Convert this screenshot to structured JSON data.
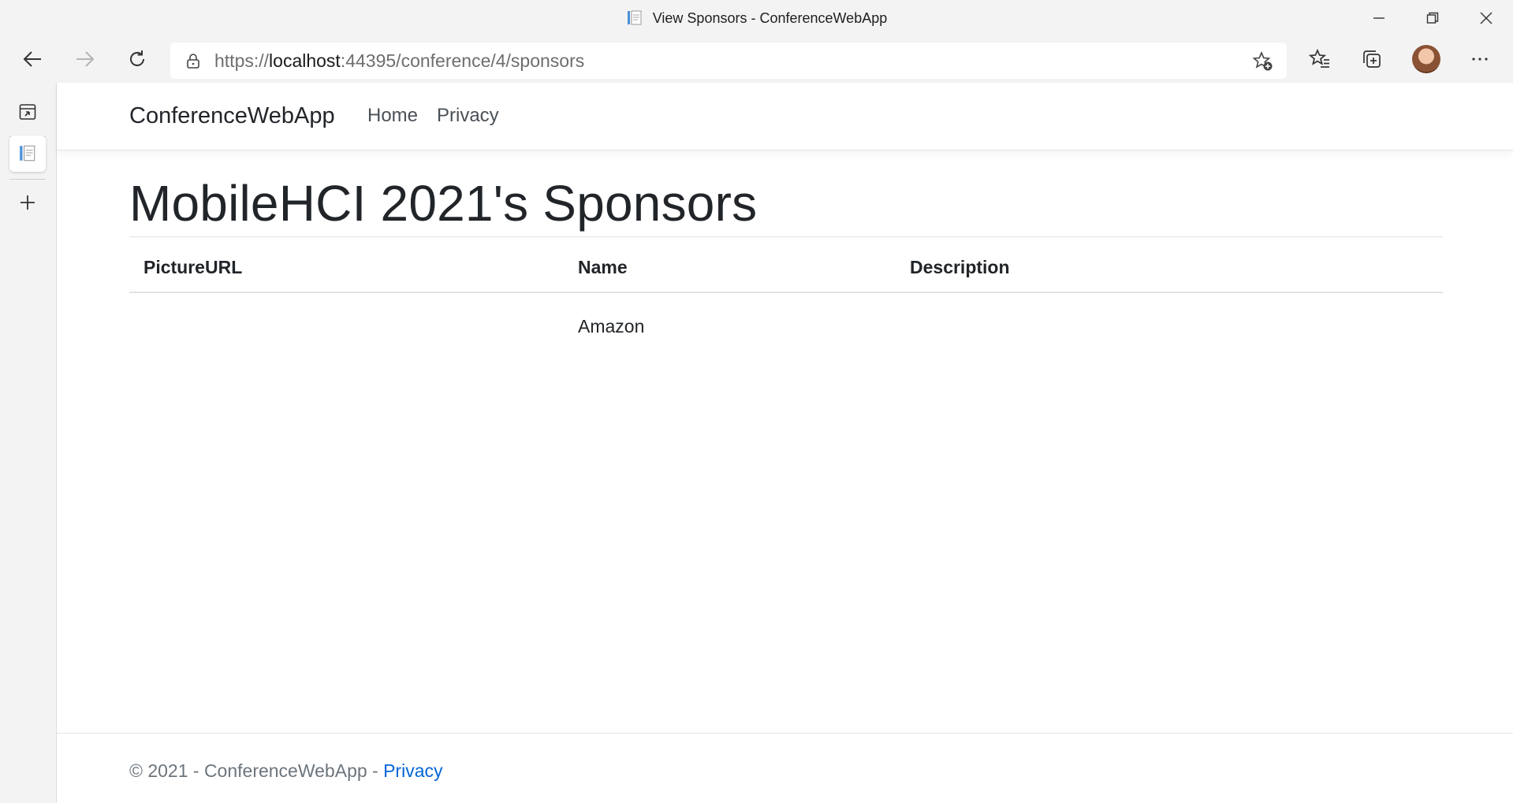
{
  "window": {
    "title": "View Sponsors - ConferenceWebApp"
  },
  "toolbar": {
    "url_scheme": "https://",
    "url_host": "localhost",
    "url_rest": ":44395/conference/4/sponsors"
  },
  "navbar": {
    "brand": "ConferenceWebApp",
    "links": [
      "Home",
      "Privacy"
    ]
  },
  "main": {
    "page_title": "MobileHCI 2021's Sponsors",
    "table": {
      "headers": [
        "PictureURL",
        "Name",
        "Description"
      ],
      "rows": [
        {
          "picture_url": "",
          "name": "Amazon",
          "description": ""
        }
      ]
    }
  },
  "footer": {
    "text": "© 2021 - ConferenceWebApp - ",
    "link": "Privacy"
  },
  "colors": {
    "link": "#0366d6",
    "text": "#212529",
    "chrome_bg": "#f3f3f3"
  }
}
